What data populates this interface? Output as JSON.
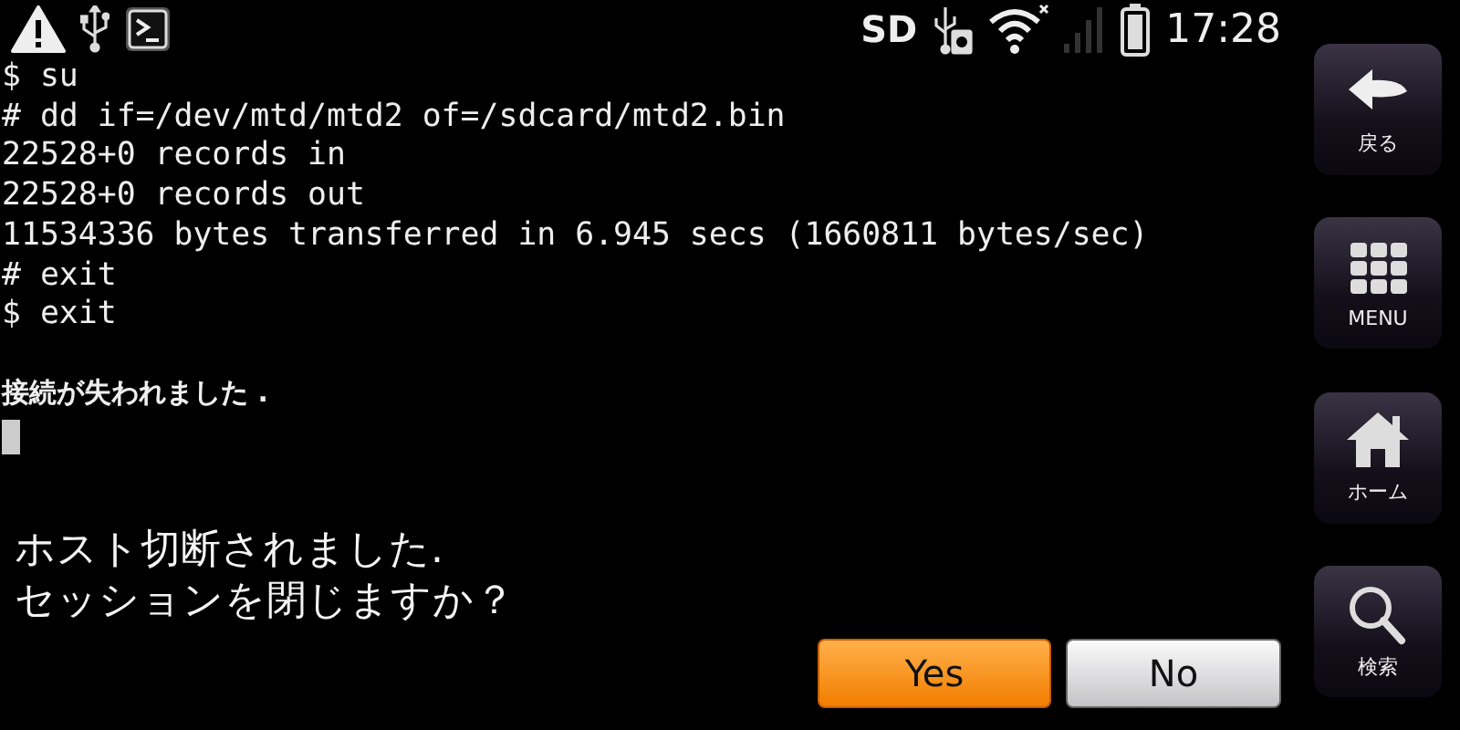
{
  "status_bar": {
    "storage_label": "SD",
    "time": "17:28"
  },
  "terminal": {
    "lines": [
      "$ su",
      "# dd if=/dev/mtd/mtd2 of=/sdcard/mtd2.bin",
      "22528+0 records in",
      "22528+0 records out",
      "11534336 bytes transferred in 6.945 secs (1660811 bytes/sec)",
      "# exit",
      "$ exit"
    ],
    "notice": "接続が失われました ."
  },
  "dialog": {
    "message": [
      "ホスト切断されました.",
      "セッションを閉じますか？"
    ],
    "buttons": [
      {
        "label": "Yes",
        "kind": "primary"
      },
      {
        "label": "No",
        "kind": "secondary"
      }
    ]
  },
  "nav_buttons": [
    {
      "label": "戻る",
      "kind": "back"
    },
    {
      "label": "MENU",
      "kind": "menu"
    },
    {
      "label": "ホーム",
      "kind": "home"
    },
    {
      "label": "検索",
      "kind": "search"
    }
  ]
}
